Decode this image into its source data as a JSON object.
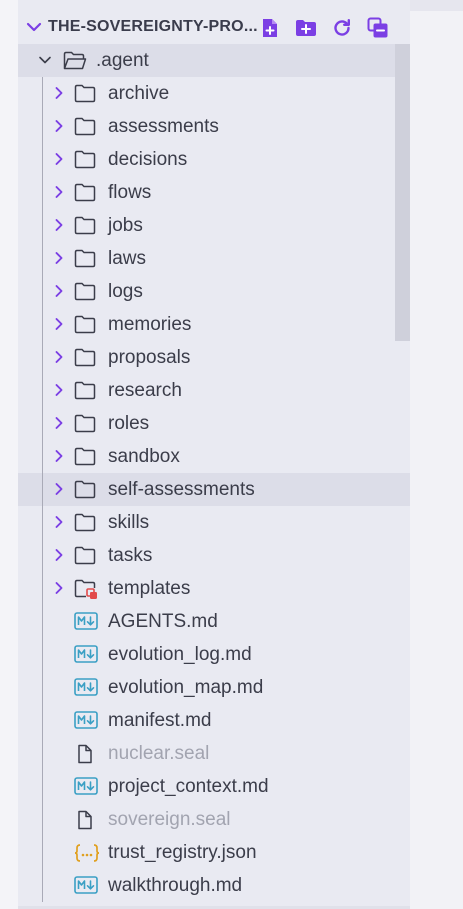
{
  "explorer": {
    "title": "THE-SOVEREIGNTY-PRO...",
    "actions": [
      {
        "name": "new-file-icon",
        "label": "New File"
      },
      {
        "name": "new-folder-icon",
        "label": "New Folder"
      },
      {
        "name": "refresh-icon",
        "label": "Refresh"
      },
      {
        "name": "collapse-all-icon",
        "label": "Collapse All"
      }
    ]
  },
  "root": {
    "label": ".agent",
    "expanded": true
  },
  "folders": [
    {
      "label": "archive"
    },
    {
      "label": "assessments"
    },
    {
      "label": "decisions"
    },
    {
      "label": "flows"
    },
    {
      "label": "jobs"
    },
    {
      "label": "laws"
    },
    {
      "label": "logs"
    },
    {
      "label": "memories"
    },
    {
      "label": "proposals"
    },
    {
      "label": "research"
    },
    {
      "label": "roles"
    },
    {
      "label": "sandbox"
    },
    {
      "label": "self-assessments",
      "hover": true
    },
    {
      "label": "skills"
    },
    {
      "label": "tasks"
    },
    {
      "label": "templates",
      "special_icon": "templates-folder-icon"
    }
  ],
  "files": [
    {
      "label": "AGENTS.md",
      "type": "markdown"
    },
    {
      "label": "evolution_log.md",
      "type": "markdown"
    },
    {
      "label": "evolution_map.md",
      "type": "markdown"
    },
    {
      "label": "manifest.md",
      "type": "markdown"
    },
    {
      "label": "nuclear.seal",
      "type": "generic",
      "dim": true
    },
    {
      "label": "project_context.md",
      "type": "markdown"
    },
    {
      "label": "sovereign.seal",
      "type": "generic",
      "dim": true
    },
    {
      "label": "trust_registry.json",
      "type": "json"
    },
    {
      "label": "walkthrough.md",
      "type": "markdown"
    }
  ],
  "colors": {
    "accent": "#7b3fe4",
    "markdown": "#3a9fc4",
    "json": "#e0a020",
    "templates_badge": "#e24b4b",
    "panel_bg": "#e9eaf2",
    "selected_bg": "#dcdde8"
  }
}
